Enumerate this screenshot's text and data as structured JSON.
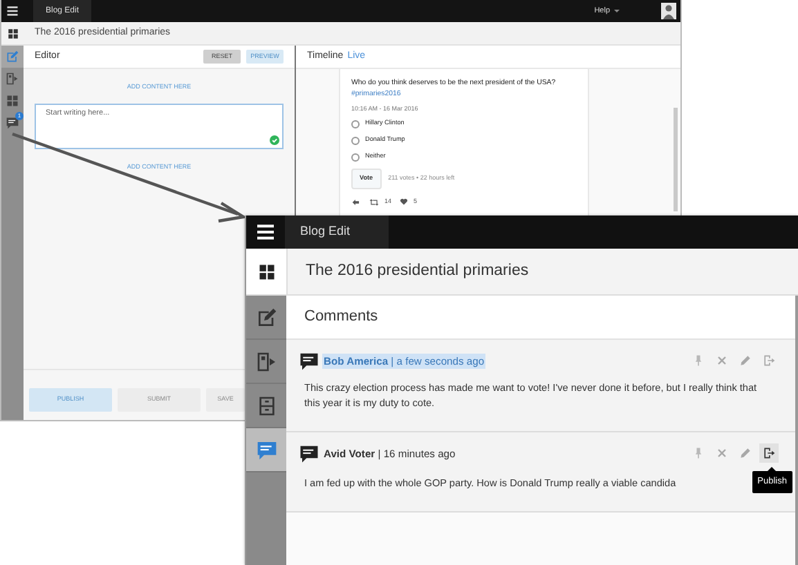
{
  "back_window": {
    "app_title": "Blog Edit",
    "help": "Help",
    "page_title": "The 2016 presidential primaries",
    "sidebar": [
      {
        "kind": "edit",
        "selected": true
      },
      {
        "kind": "export",
        "selected": false
      },
      {
        "kind": "grid",
        "selected": false
      },
      {
        "kind": "comment",
        "selected": false,
        "badge": "1"
      }
    ],
    "editor": {
      "title": "Editor",
      "buttons": [
        {
          "label": "RESET",
          "kind": "secondary"
        },
        {
          "label": "PREVIEW",
          "kind": "primary"
        }
      ],
      "add_content_top": "ADD CONTENT HERE",
      "placeholder": "Start writing here...",
      "add_content_bottom": "ADD CONTENT HERE",
      "footer_buttons": [
        {
          "label": "PUBLISH",
          "kind": "primary"
        },
        {
          "label": "SUBMIT",
          "kind": "secondary"
        },
        {
          "label": "SAVE",
          "kind": "secondary"
        }
      ]
    },
    "timeline": {
      "title": "Timeline",
      "status": "Live",
      "tweet": {
        "question": "Who do you think deserves to be the next president of the USA?",
        "hashtag": "#primaries2016",
        "time": "10:16 AM - 16 Mar 2016",
        "options": [
          {
            "label": "Hillary Clinton",
            "selected": false
          },
          {
            "label": "Donald Trump",
            "selected": false
          },
          {
            "label": "Neither",
            "selected": false
          }
        ],
        "vote_button": "Vote",
        "vote_info": "211 votes • 22 hours left",
        "retweets": "14",
        "likes": "5"
      }
    }
  },
  "front_window": {
    "app_title": "Blog Edit",
    "page_title": "The 2016 presidential primaries",
    "sidebar": [
      {
        "kind": "edit",
        "selected": false
      },
      {
        "kind": "export",
        "selected": false
      },
      {
        "kind": "archive",
        "selected": false
      },
      {
        "kind": "comment",
        "selected": true
      }
    ],
    "section_title": "Comments",
    "comments": [
      {
        "header": "**Bob America** | a few seconds ago",
        "highlighted": true,
        "text": "This crazy election process has made me want to vote! I've never done it before, but I really think that this year it is my duty to cote.",
        "actions": [
          {
            "kind": "pin",
            "active": false
          },
          {
            "kind": "close",
            "active": false
          },
          {
            "kind": "pencil",
            "active": false
          },
          {
            "kind": "publish",
            "active": false
          }
        ]
      },
      {
        "header": "**Avid Voter** | 16 minutes ago",
        "highlighted": false,
        "text": "I am fed up with the whole GOP party. How is Donald Trump really a viable candida",
        "actions": [
          {
            "kind": "pin",
            "active": false
          },
          {
            "kind": "close",
            "active": false
          },
          {
            "kind": "pencil",
            "active": false
          },
          {
            "kind": "publish",
            "active": true
          }
        ],
        "tooltip": "Publish"
      }
    ]
  }
}
